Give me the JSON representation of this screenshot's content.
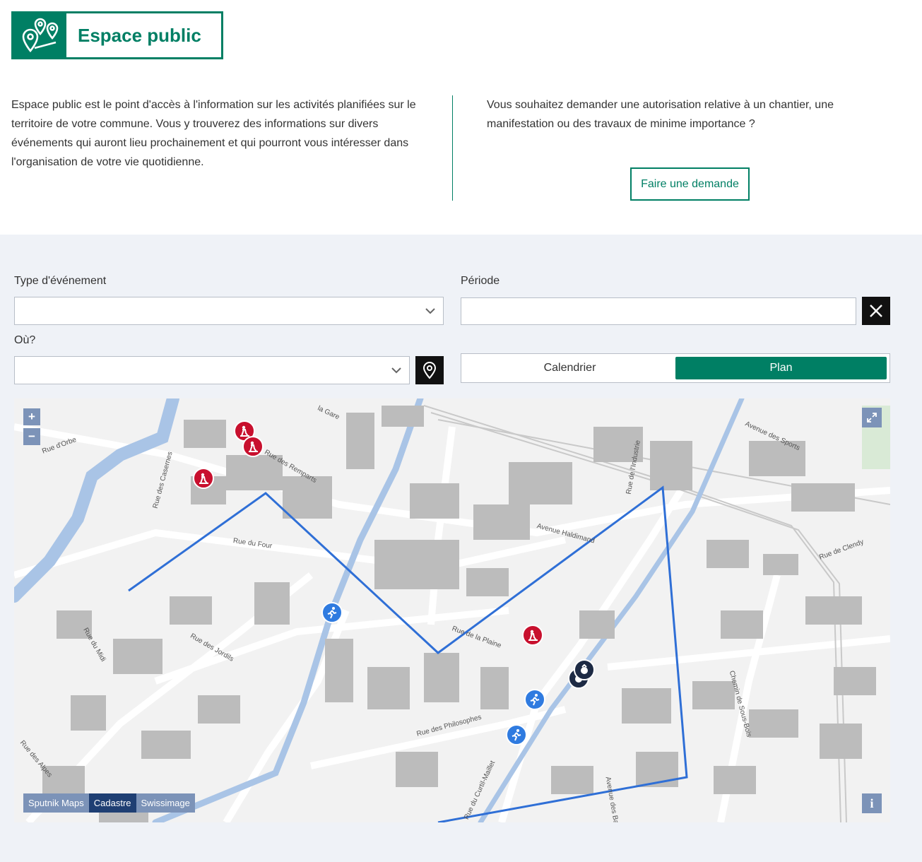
{
  "header": {
    "title": "Espace public",
    "intro": "Espace public est le point d'accès à l'information sur les activités planifiées sur le territoire de votre commune. Vous y trouverez des informations sur divers événements qui auront lieu prochainement et qui pourront vous intéresser dans l'organisation de votre vie quotidienne.",
    "request_text": "Vous souhaitez demander une autorisation relative à un chantier, une manifestation ou des travaux de minime importance ?",
    "request_button": "Faire une demande",
    "brand_color": "#007f64"
  },
  "filters": {
    "type_label": "Type d'événement",
    "type_value": "",
    "period_label": "Période",
    "period_value": "",
    "where_label": "Où?",
    "where_value": ""
  },
  "view_toggle": {
    "options": [
      "Calendrier",
      "Plan"
    ],
    "selected": "Plan"
  },
  "map": {
    "zoom_in": "+",
    "zoom_out": "−",
    "layers": [
      "Sputnik Maps",
      "Cadastre",
      "Swissimage"
    ],
    "active_layer": "Cadastre",
    "info": "i",
    "streets": [
      "Rue d'Orbe",
      "Rue des Casernes",
      "Rue des Remparts",
      "Rue du Four",
      "la Gare",
      "Avenue Haldimand",
      "Rue de la Plaine",
      "Rue des Jordils",
      "Rue du Midi",
      "Rue des Philosophes",
      "Avenue des Sports",
      "Rue de l'Industrie",
      "Rue de Clendy",
      "Chemin de Sous-Bois",
      "Rue du Curtil-Maillet",
      "Avenue des Bains",
      "Rue des Alpes"
    ],
    "markers": [
      {
        "type": "works",
        "icon": "roadworks-icon"
      },
      {
        "type": "works",
        "icon": "roadworks-icon"
      },
      {
        "type": "works",
        "icon": "roadworks-icon"
      },
      {
        "type": "works",
        "icon": "roadworks-icon"
      },
      {
        "type": "sport",
        "icon": "running-icon"
      },
      {
        "type": "sport",
        "icon": "running-icon"
      },
      {
        "type": "sport",
        "icon": "running-icon"
      },
      {
        "type": "event",
        "icon": "event-icon"
      },
      {
        "type": "event",
        "icon": "event-icon"
      }
    ],
    "colors": {
      "water": "#a9c4e6",
      "buildings": "#bcbcbc",
      "perimeter": "#2f6fd6",
      "works": "#c8102e",
      "sport": "#2f7be0",
      "event": "#1d2a44"
    }
  }
}
